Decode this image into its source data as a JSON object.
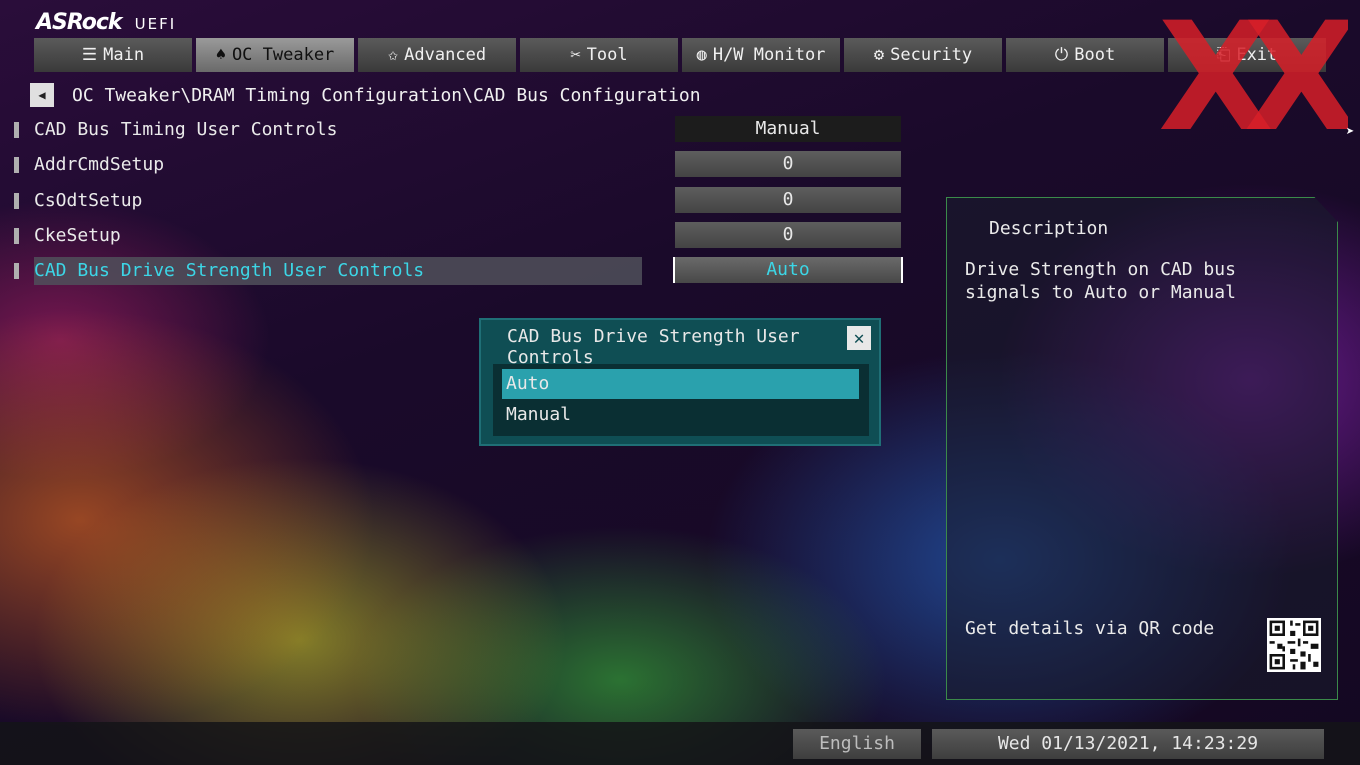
{
  "brand": {
    "name": "ASRock",
    "suffix": "UEFI"
  },
  "tabs": [
    {
      "label": "Main",
      "icon": "list-icon",
      "glyph": "☰"
    },
    {
      "label": "OC Tweaker",
      "icon": "rocket-icon",
      "glyph": "♠"
    },
    {
      "label": "Advanced",
      "icon": "star-icon",
      "glyph": "✩"
    },
    {
      "label": "Tool",
      "icon": "tools-icon",
      "glyph": "✂"
    },
    {
      "label": "H/W Monitor",
      "icon": "monitor-icon",
      "glyph": "◍"
    },
    {
      "label": "Security",
      "icon": "shield-icon",
      "glyph": "⚙"
    },
    {
      "label": "Boot",
      "icon": "power-icon",
      "glyph": "⏻"
    },
    {
      "label": "Exit",
      "icon": "exit-icon",
      "glyph": "⎗"
    }
  ],
  "active_tab": "OC Tweaker",
  "breadcrumb": {
    "path": "OC Tweaker\\DRAM Timing Configuration\\CAD Bus Configuration"
  },
  "settings": [
    {
      "label": "CAD Bus Timing User Controls",
      "value": "Manual"
    },
    {
      "label": "AddrCmdSetup",
      "value": "0"
    },
    {
      "label": "CsOdtSetup",
      "value": "0"
    },
    {
      "label": "CkeSetup",
      "value": "0"
    },
    {
      "label": "CAD Bus Drive Strength User Controls",
      "value": "Auto"
    }
  ],
  "description": {
    "title": "Description",
    "text": "Drive Strength on CAD bus signals to Auto or Manual",
    "qr_text": "Get details via QR code"
  },
  "popup": {
    "title": "CAD Bus Drive Strength User Controls",
    "options": [
      "Auto",
      "Manual"
    ],
    "selected": "Auto"
  },
  "footer": {
    "language": "English",
    "datetime": "Wed 01/13/2021, 14:23:29"
  },
  "colors": {
    "accent": "#3cd6e6",
    "popup_bg": "#0f4e54",
    "popup_selected": "#2aa1ad",
    "watermark": "#d71e28"
  }
}
